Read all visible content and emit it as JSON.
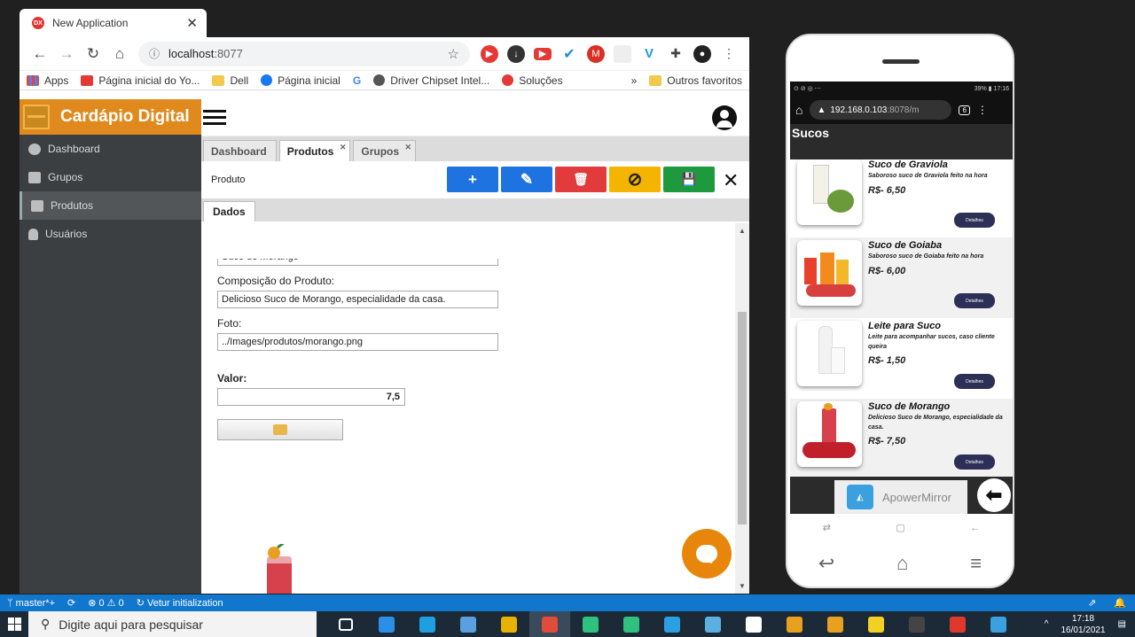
{
  "browser": {
    "tab_title": "New Application",
    "tab_favicon_text": "DX",
    "url_host": "localhost",
    "url_port": ":8077",
    "bookmarks": [
      "Apps",
      "Página inicial do Yo...",
      "Dell",
      "Página inicial",
      "Driver Chipset Intel...",
      "Soluções",
      "Outros favoritos"
    ],
    "more_chevron": "»"
  },
  "app": {
    "brand": "Cardápio Digital",
    "menu": [
      {
        "label": "Dashboard",
        "icon": "pie-chart-icon"
      },
      {
        "label": "Grupos",
        "icon": "inbox-icon"
      },
      {
        "label": "Produtos",
        "icon": "cart-icon"
      },
      {
        "label": "Usuários",
        "icon": "user-icon"
      }
    ],
    "tabs": [
      "Dashboard",
      "Produtos",
      "Grupos"
    ],
    "toolbar_caption": "Produto",
    "toolbar_buttons": [
      {
        "name": "add",
        "color": "#1f73e0",
        "glyph": "+"
      },
      {
        "name": "edit",
        "color": "#1f73e0",
        "glyph": "✎"
      },
      {
        "name": "delete",
        "color": "#e23b3b",
        "glyph": "🗑"
      },
      {
        "name": "cancel",
        "color": "#f4b400",
        "glyph": "⊘"
      },
      {
        "name": "save",
        "color": "#1e9a3e",
        "glyph": "💾"
      }
    ],
    "subtab": "Dados",
    "form": {
      "name_value": "Suco de Morango",
      "composition_label": "Composição do Produto:",
      "composition_value": "Delicioso Suco de Morango, especialidade da casa.",
      "photo_label": "Foto:",
      "photo_value": "../Images/produtos/morango.png",
      "value_label": "Valor:",
      "value_value": "7,5"
    }
  },
  "phone": {
    "status_left": "⊙ ⊘ ◎ ⋯",
    "status_right": "39% ▮ 17:16",
    "url": "192.168.0.103",
    "url_port": ":8078/m",
    "tab_count": "6",
    "header": "Sucos",
    "products": [
      {
        "name": "Suco de Graviola",
        "desc": "Saboroso suco de Graviola feito na hora",
        "price": "R$- 6,50",
        "btn": "Detalhes"
      },
      {
        "name": "Suco de Goiaba",
        "desc": "Saboroso suco de Goiaba feito na hora",
        "price": "R$- 6,00",
        "btn": "Detalhes"
      },
      {
        "name": "Leite para Suco",
        "desc": "Leite para acompanhar sucos, caso cliente queira",
        "price": "R$- 1,50",
        "btn": "Detalhes"
      },
      {
        "name": "Suco de Morango",
        "desc": "Delicioso Suco de Morango, especialidade da casa.",
        "price": "R$- 7,50",
        "btn": "Detalhes"
      }
    ],
    "mirror_label": "ApowerMirror"
  },
  "statusbar": {
    "branch": "master*+",
    "problems": "⊗ 0 ⚠ 0",
    "task": "Vetur initialization"
  },
  "taskbar": {
    "search_placeholder": "Digite aqui para pesquisar",
    "time": "17:18",
    "date": "16/01/2021",
    "apps": [
      "#ffffff00",
      "#2b8fe8",
      "#1ea0e0",
      "#5aa0e0",
      "#e8b200",
      "#e04c3c",
      "#2ec27e",
      "#2ec27e",
      "#2aa0e0",
      "#5ab0e0",
      "#ffffff",
      "#e8a020",
      "#e8a020",
      "#f2d024",
      "#444444",
      "#e0382c",
      "#3aa0e0"
    ]
  }
}
